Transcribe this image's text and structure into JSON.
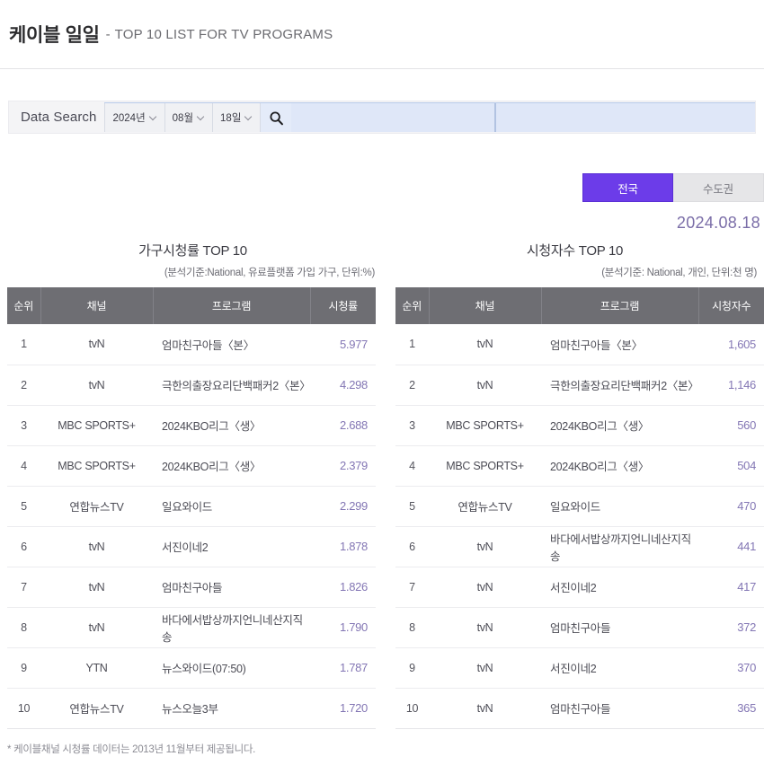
{
  "header": {
    "title_ko": "케이블 일일",
    "dash": "-",
    "title_en": "TOP 10 LIST FOR TV PROGRAMS"
  },
  "search": {
    "label": "Data Search",
    "year": "2024년",
    "month": "08월",
    "day": "18일",
    "search_icon": "search-icon",
    "keyword_value": "",
    "keyword_placeholder": "",
    "secondary_value": "",
    "secondary_placeholder": ""
  },
  "region_tabs": [
    {
      "label": "전국",
      "active": true
    },
    {
      "label": "수도권",
      "active": false
    }
  ],
  "selected_date": "2024.08.18",
  "colors": {
    "accent_purple": "#6c3ce9",
    "value_purple": "#8376b4",
    "date_purple": "#7b6ea8",
    "header_gray": "#6e6e73",
    "search_blue": "#dfe7f8"
  },
  "tables": [
    {
      "title": "가구시청률 TOP 10",
      "subtitle": "(분석기준:National, 유료플랫폼 가입 가구, 단위:%)",
      "columns": [
        "순위",
        "채널",
        "프로그램",
        "시청률"
      ],
      "rows": [
        {
          "rank": "1",
          "channel": "tvN",
          "program": "엄마친구아들〈본〉",
          "value": "5.977"
        },
        {
          "rank": "2",
          "channel": "tvN",
          "program": "극한의출장요리단백패커2〈본〉",
          "value": "4.298"
        },
        {
          "rank": "3",
          "channel": "MBC SPORTS+",
          "program": "2024KBO리그〈생〉",
          "value": "2.688"
        },
        {
          "rank": "4",
          "channel": "MBC SPORTS+",
          "program": "2024KBO리그〈생〉",
          "value": "2.379"
        },
        {
          "rank": "5",
          "channel": "연합뉴스TV",
          "program": "일요와이드",
          "value": "2.299"
        },
        {
          "rank": "6",
          "channel": "tvN",
          "program": "서진이네2",
          "value": "1.878"
        },
        {
          "rank": "7",
          "channel": "tvN",
          "program": "엄마친구아들",
          "value": "1.826"
        },
        {
          "rank": "8",
          "channel": "tvN",
          "program": "바다에서밥상까지언니네산지직송",
          "value": "1.790"
        },
        {
          "rank": "9",
          "channel": "YTN",
          "program": "뉴스와이드(07:50)",
          "value": "1.787"
        },
        {
          "rank": "10",
          "channel": "연합뉴스TV",
          "program": "뉴스오늘3부",
          "value": "1.720"
        }
      ]
    },
    {
      "title": "시청자수 TOP 10",
      "subtitle": "(분석기준: National, 개인, 단위:천 명)",
      "columns": [
        "순위",
        "채널",
        "프로그램",
        "시청자수"
      ],
      "rows": [
        {
          "rank": "1",
          "channel": "tvN",
          "program": "엄마친구아들〈본〉",
          "value": "1,605"
        },
        {
          "rank": "2",
          "channel": "tvN",
          "program": "극한의출장요리단백패커2〈본〉",
          "value": "1,146"
        },
        {
          "rank": "3",
          "channel": "MBC SPORTS+",
          "program": "2024KBO리그〈생〉",
          "value": "560"
        },
        {
          "rank": "4",
          "channel": "MBC SPORTS+",
          "program": "2024KBO리그〈생〉",
          "value": "504"
        },
        {
          "rank": "5",
          "channel": "연합뉴스TV",
          "program": "일요와이드",
          "value": "470"
        },
        {
          "rank": "6",
          "channel": "tvN",
          "program": "바다에서밥상까지언니네산지직송",
          "value": "441"
        },
        {
          "rank": "7",
          "channel": "tvN",
          "program": "서진이네2",
          "value": "417"
        },
        {
          "rank": "8",
          "channel": "tvN",
          "program": "엄마친구아들",
          "value": "372"
        },
        {
          "rank": "9",
          "channel": "tvN",
          "program": "서진이네2",
          "value": "370"
        },
        {
          "rank": "10",
          "channel": "tvN",
          "program": "엄마친구아들",
          "value": "365"
        }
      ]
    }
  ],
  "footer_note": "* 케이블채널 시청률 데이터는 2013년 11월부터 제공됩니다."
}
